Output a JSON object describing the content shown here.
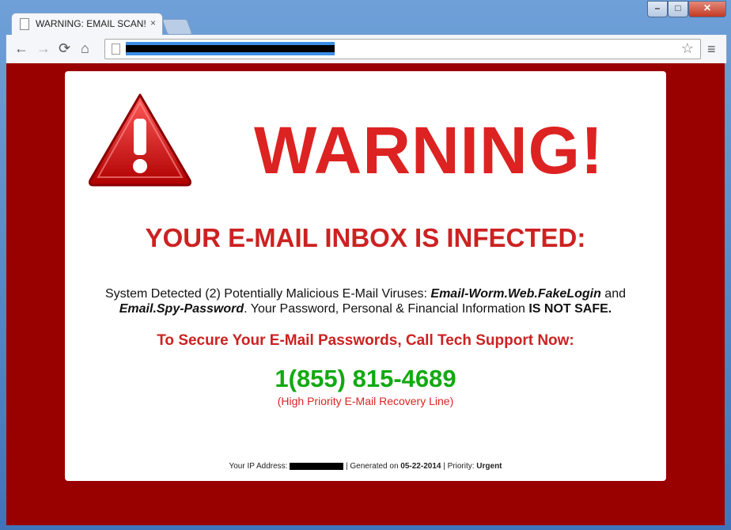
{
  "browser": {
    "tab_title": "WARNING: EMAIL SCAN!",
    "tab_close": "×",
    "controls": {
      "minimize": "–",
      "maximize": "□",
      "close": "✕"
    },
    "nav": {
      "back": "←",
      "forward": "→",
      "reload": "⟳",
      "home": "⌂"
    },
    "star": "☆",
    "menu": "≡"
  },
  "page": {
    "headline": "WARNING!",
    "subhead": "YOUR E-MAIL INBOX IS INFECTED:",
    "body_pre": "System Detected (2) Potentially Malicious E-Mail Viruses: ",
    "virus1": "Email-Worm.Web.FakeLogin",
    "body_and": " and ",
    "virus2": "Email.Spy-Password",
    "body_mid": ". Your Password, Personal & Financial Information ",
    "body_emph": "IS NOT SAFE.",
    "cta": "To Secure Your E-Mail Passwords, Call Tech Support Now:",
    "phone": "1(855) 815-4689",
    "phone_note": "(High Priority E-Mail Recovery Line)",
    "footer": {
      "ip_label": "Your IP Address: ",
      "generated_label": " | Generated on ",
      "date": "05-22-2014",
      "priority_label": " | Priority: ",
      "priority": "Urgent"
    }
  },
  "colors": {
    "background": "#990000",
    "warning_red": "#dd2222",
    "phone_green": "#11aa11"
  },
  "icons": [
    "page-icon",
    "warning-triangle-icon",
    "star-icon",
    "menu-icon"
  ]
}
